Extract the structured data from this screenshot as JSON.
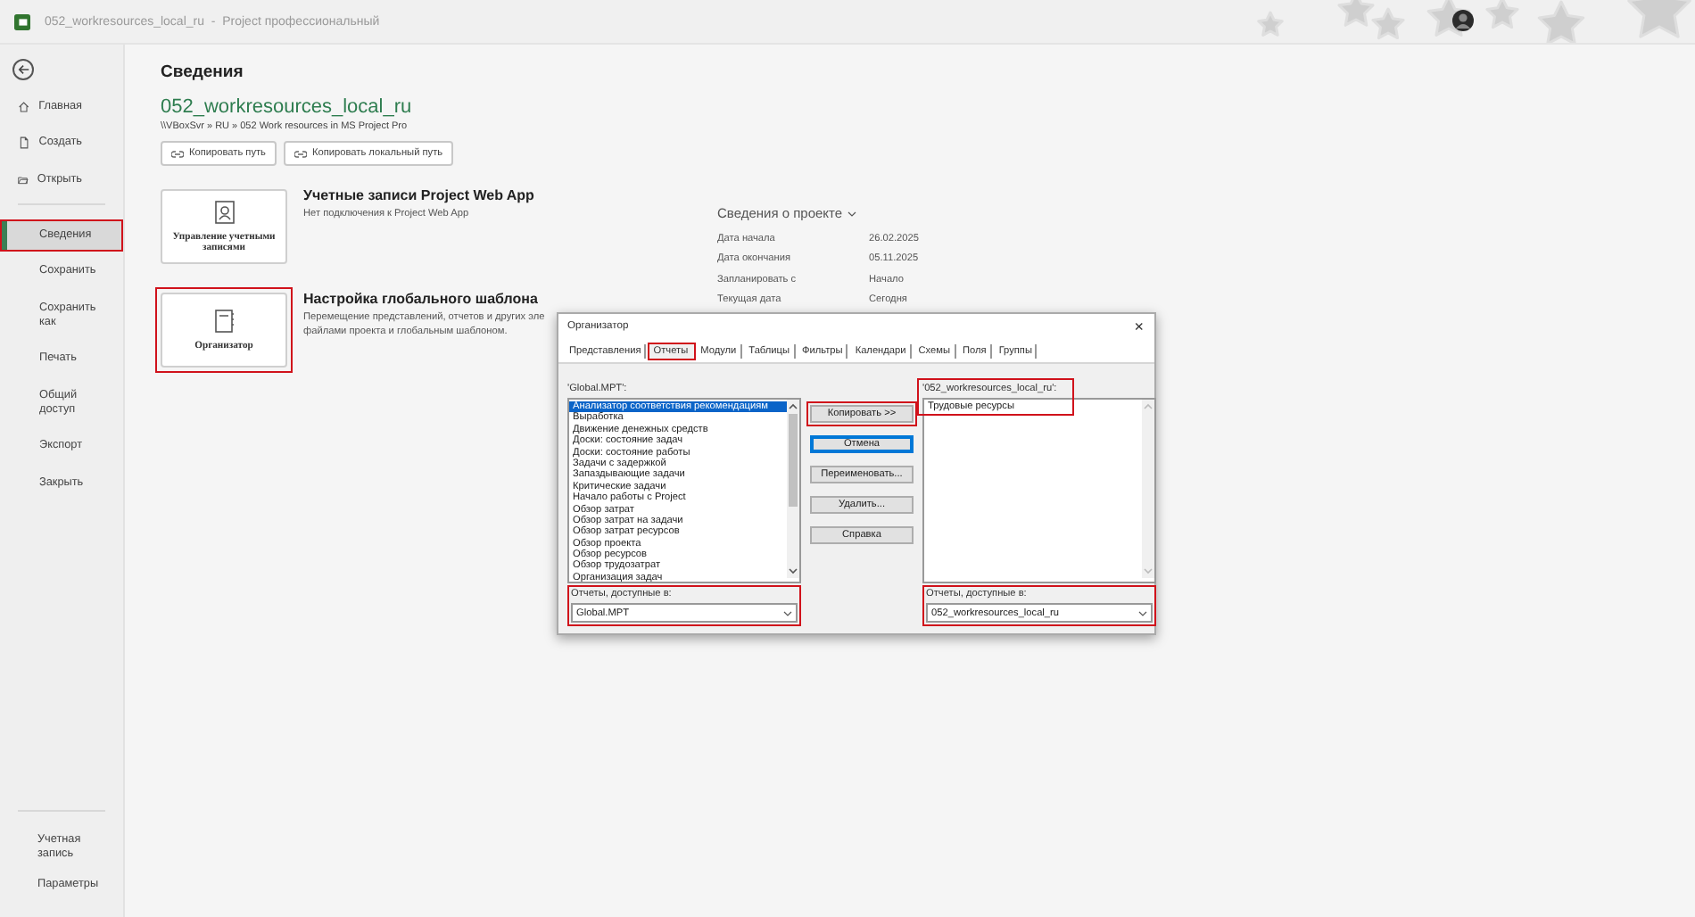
{
  "title_bar": {
    "title": "052_workresources_local_ru  -  Project профессиональный"
  },
  "sidebar": {
    "items": [
      {
        "label": "Главная",
        "selected": false,
        "highlighted": false
      },
      {
        "label": "Создать",
        "selected": false,
        "highlighted": false
      },
      {
        "label": "Открыть",
        "selected": false,
        "highlighted": false
      },
      {
        "label": "Сведения",
        "selected": true,
        "highlighted": true
      },
      {
        "label": "Сохранить",
        "selected": false,
        "highlighted": false
      },
      {
        "label": "Сохранить как",
        "selected": false,
        "highlighted": false
      },
      {
        "label": "Печать",
        "selected": false,
        "highlighted": false
      },
      {
        "label": "Общий доступ",
        "selected": false,
        "highlighted": false
      },
      {
        "label": "Экспорт",
        "selected": false,
        "highlighted": false
      },
      {
        "label": "Закрыть",
        "selected": false,
        "highlighted": false
      }
    ],
    "bottom_items": [
      {
        "label": "Учетная запись"
      },
      {
        "label": "Параметры"
      }
    ]
  },
  "page": {
    "heading": "Сведения",
    "file_name": "052_workresources_local_ru",
    "path": "\\\\VBoxSvr » RU » 052 Work resources in MS Project Pro",
    "path_buttons": [
      "Копировать путь",
      "Копировать локальный путь"
    ],
    "sections": [
      {
        "tile": "Управление учетными записями",
        "title": "Учетные записи Project Web App",
        "description": "Нет подключения к Project Web App",
        "highlighted": false
      },
      {
        "tile": "Организатор",
        "title": "Настройка глобального шаблона",
        "description": "Перемещение представлений, отчетов и других эле файлами проекта и глобальным шаблоном.",
        "highlighted": true
      }
    ]
  },
  "project_info": {
    "heading": "Сведения о проекте",
    "rows": [
      {
        "label": "Дата начала",
        "value": "26.02.2025"
      },
      {
        "label": "Дата окончания",
        "value": "05.11.2025"
      },
      {
        "label": "Запланировать с",
        "value": "Начало"
      },
      {
        "label": "Текущая дата",
        "value": "Сегодня"
      }
    ]
  },
  "dialog": {
    "title": "Организатор",
    "close": "×",
    "tabs": [
      {
        "label": "Представления",
        "selected": false,
        "highlighted": false
      },
      {
        "label": "Отчеты",
        "selected": true,
        "highlighted": true
      },
      {
        "label": "Модули",
        "selected": false,
        "highlighted": false
      },
      {
        "label": "Таблицы",
        "selected": false,
        "highlighted": false
      },
      {
        "label": "Фильтры",
        "selected": false,
        "highlighted": false
      },
      {
        "label": "Календари",
        "selected": false,
        "highlighted": false
      },
      {
        "label": "Схемы",
        "selected": false,
        "highlighted": false
      },
      {
        "label": "Поля",
        "selected": false,
        "highlighted": false
      },
      {
        "label": "Группы",
        "selected": false,
        "highlighted": false
      }
    ],
    "left": {
      "caption": "'Global.MPT':",
      "caption_highlighted": false,
      "items": [
        {
          "label": "Анализатор соответствия рекомендациям",
          "selected": true
        },
        {
          "label": "Выработка",
          "selected": false
        },
        {
          "label": "Движение денежных средств",
          "selected": false
        },
        {
          "label": "Доски: состояние задач",
          "selected": false
        },
        {
          "label": "Доски: состояние работы",
          "selected": false
        },
        {
          "label": "Задачи с задержкой",
          "selected": false
        },
        {
          "label": "Запаздывающие задачи",
          "selected": false
        },
        {
          "label": "Критические задачи",
          "selected": false
        },
        {
          "label": "Начало работы с Project",
          "selected": false
        },
        {
          "label": "Обзор затрат",
          "selected": false
        },
        {
          "label": "Обзор затрат на задачи",
          "selected": false
        },
        {
          "label": "Обзор затрат ресурсов",
          "selected": false
        },
        {
          "label": "Обзор проекта",
          "selected": false
        },
        {
          "label": "Обзор ресурсов",
          "selected": false
        },
        {
          "label": "Обзор трудозатрат",
          "selected": false
        },
        {
          "label": "Организация задач",
          "selected": false
        }
      ],
      "available_label": "Отчеты, доступные в:",
      "available_value": "Global.MPT",
      "available_highlighted": true
    },
    "right": {
      "caption": "'052_workresources_local_ru':",
      "caption_highlighted": true,
      "items": [
        {
          "label": "Трудовые ресурсы",
          "selected": false
        }
      ],
      "available_label": "Отчеты, доступные в:",
      "available_value": "052_workresources_local_ru",
      "available_highlighted": true
    },
    "buttons": [
      {
        "label": "Копировать >>",
        "highlighted": true,
        "default": false
      },
      {
        "label": "Отмена",
        "highlighted": false,
        "default": true
      },
      {
        "label": "Переименовать...",
        "highlighted": false,
        "default": false
      },
      {
        "label": "Удалить...",
        "highlighted": false,
        "default": false
      },
      {
        "label": "Справка",
        "highlighted": false,
        "default": false
      }
    ]
  }
}
